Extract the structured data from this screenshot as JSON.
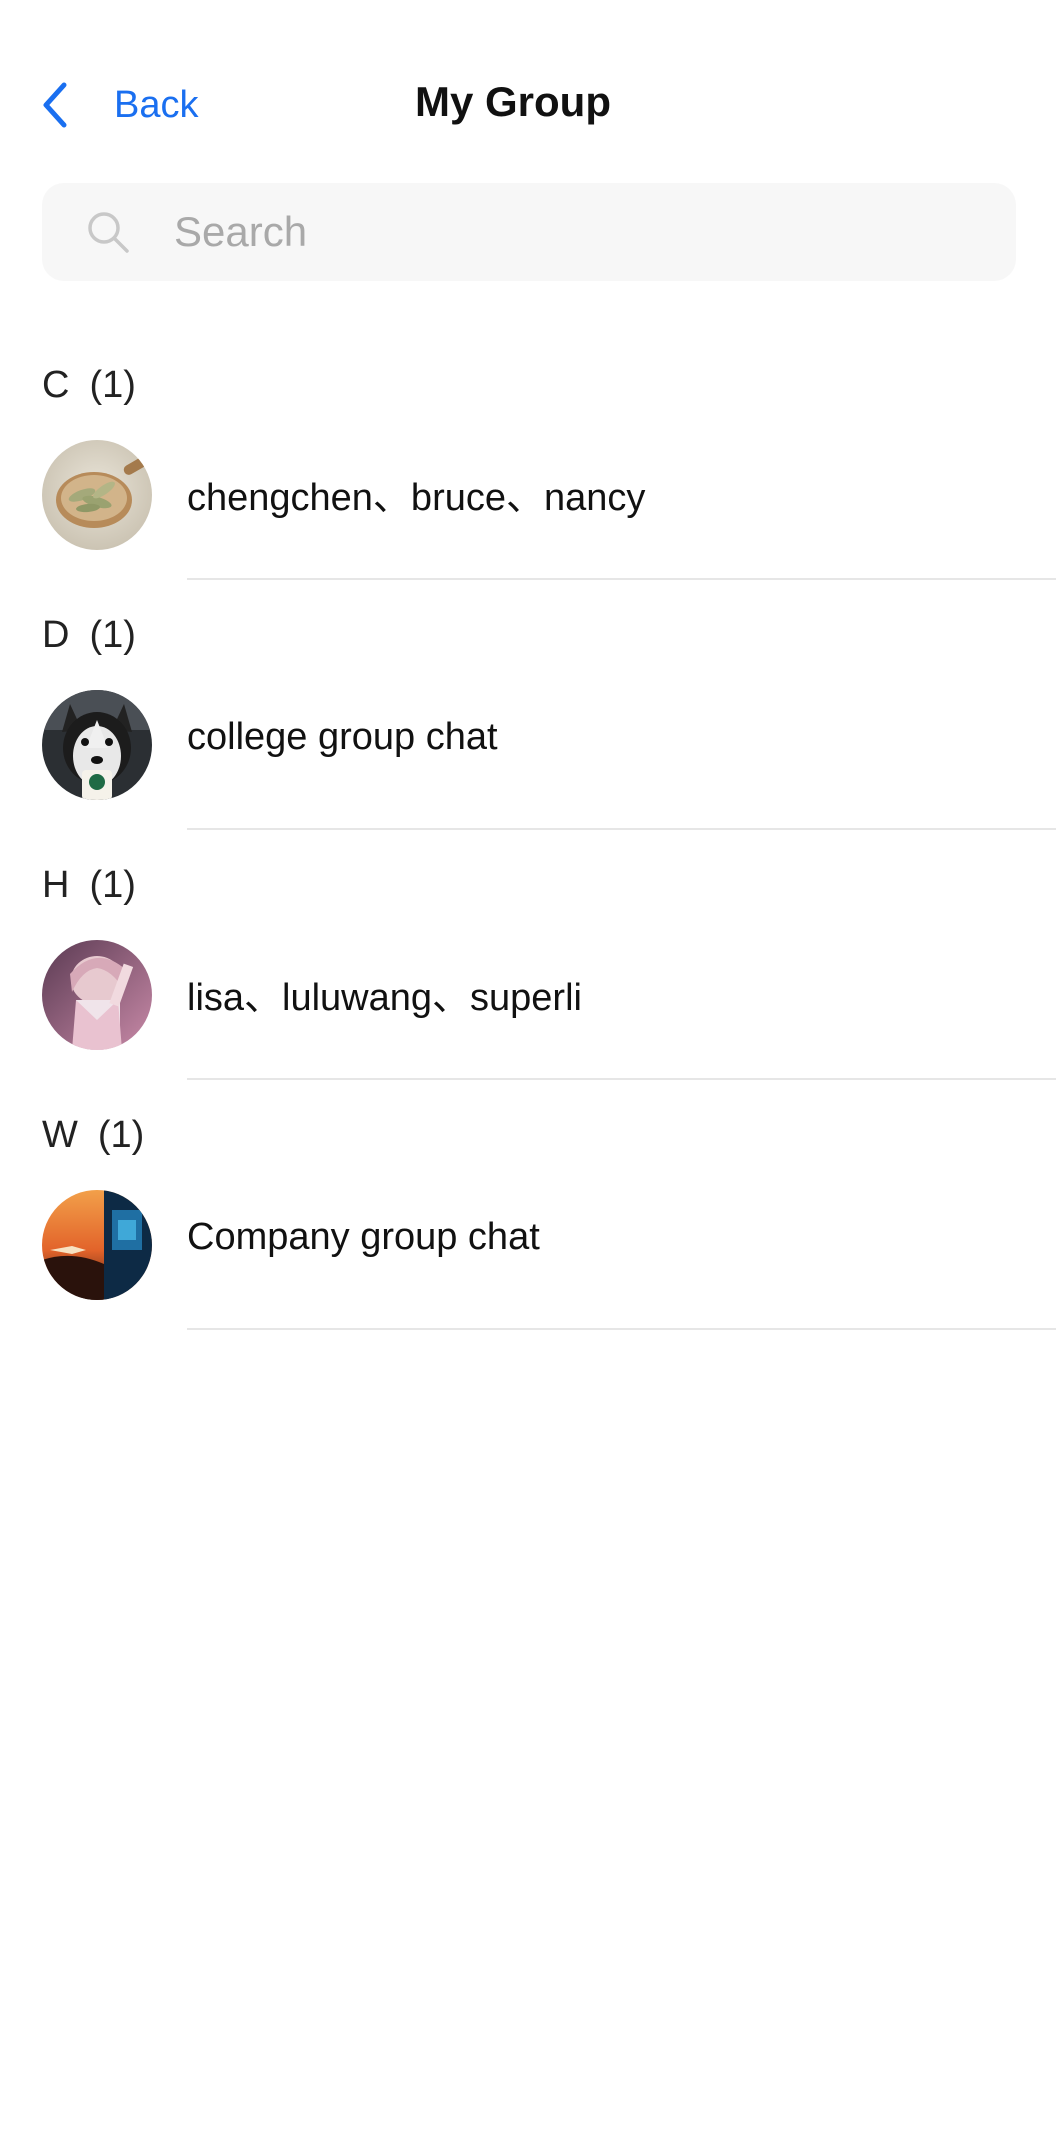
{
  "header": {
    "back_label": "Back",
    "title": "My Group"
  },
  "search": {
    "placeholder": "Search"
  },
  "sections": [
    {
      "letter": "C",
      "count": "(1)",
      "items": [
        {
          "label": "chengchen、bruce、nancy",
          "avatar": "dried-leaves-spoon"
        }
      ]
    },
    {
      "letter": "D",
      "count": "(1)",
      "items": [
        {
          "label": "college group chat",
          "avatar": "husky-dog"
        }
      ]
    },
    {
      "letter": "H",
      "count": "(1)",
      "items": [
        {
          "label": "lisa、luluwang、superli",
          "avatar": "anime-character"
        }
      ]
    },
    {
      "letter": "W",
      "count": "(1)",
      "items": [
        {
          "label": "Company group chat",
          "avatar": "sunset-landscape"
        }
      ]
    }
  ],
  "colors": {
    "accent": "#1a6ff0",
    "search_bg": "#f7f7f7",
    "divider": "#e6e6e6"
  }
}
